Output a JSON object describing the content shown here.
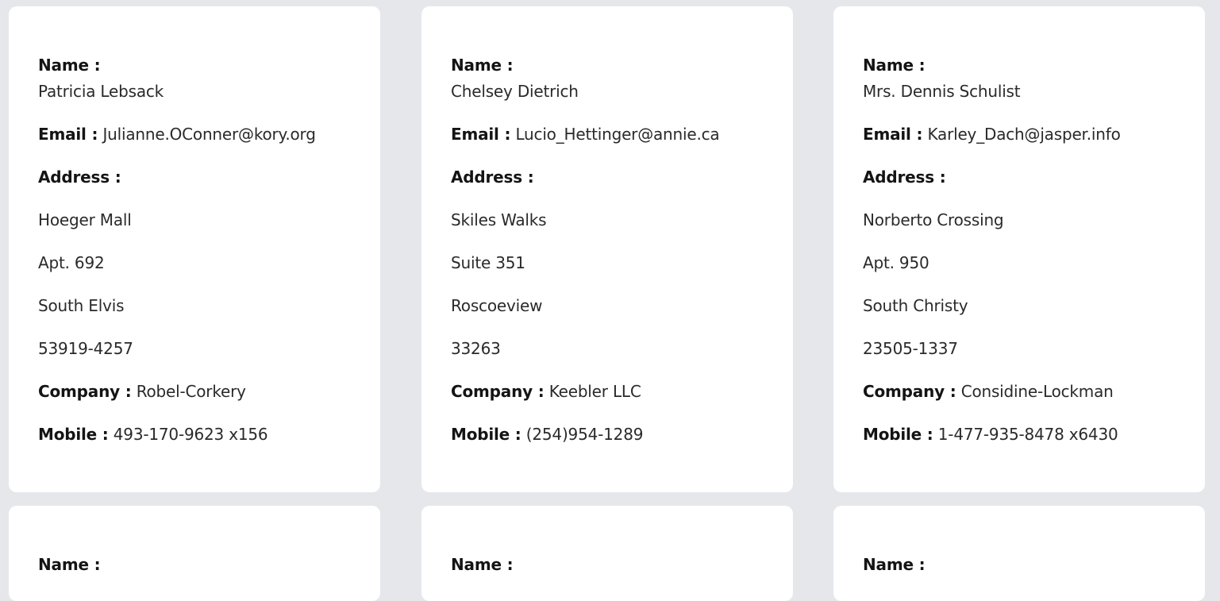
{
  "labels": {
    "name": "Name :",
    "email": "Email :",
    "address": "Address :",
    "company": "Company :",
    "mobile": "Mobile :"
  },
  "users": [
    {
      "name": "Patricia Lebsack",
      "email": "Julianne.OConner@kory.org",
      "address": {
        "street": "Hoeger Mall",
        "suite": "Apt. 692",
        "city": "South Elvis",
        "zipcode": "53919-4257"
      },
      "company": "Robel-Corkery",
      "mobile": "493-170-9623 x156"
    },
    {
      "name": "Chelsey Dietrich",
      "email": "Lucio_Hettinger@annie.ca",
      "address": {
        "street": "Skiles Walks",
        "suite": "Suite 351",
        "city": "Roscoeview",
        "zipcode": "33263"
      },
      "company": "Keebler LLC",
      "mobile": "(254)954-1289"
    },
    {
      "name": "Mrs. Dennis Schulist",
      "email": "Karley_Dach@jasper.info",
      "address": {
        "street": "Norberto Crossing",
        "suite": "Apt. 950",
        "city": "South Christy",
        "zipcode": "23505-1337"
      },
      "company": "Considine-Lockman",
      "mobile": "1-477-935-8478 x6430"
    }
  ]
}
